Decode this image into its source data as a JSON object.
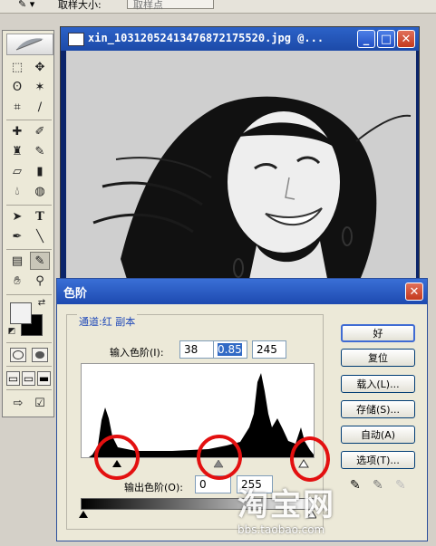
{
  "options_bar": {
    "sample_size_label": "取样大小:",
    "sample_size_value": "取样点"
  },
  "toolbox": {
    "tools": [
      "marquee-icon",
      "move-icon",
      "lasso-icon",
      "magic-wand-icon",
      "crop-icon",
      "slice-icon",
      "healing-brush-icon",
      "brush-icon",
      "clone-stamp-icon",
      "history-brush-icon",
      "eraser-icon",
      "gradient-icon",
      "blur-icon",
      "dodge-icon",
      "path-select-icon",
      "type-icon",
      "pen-icon",
      "line-icon",
      "notes-icon",
      "eyedropper-icon",
      "hand-icon",
      "zoom-icon"
    ],
    "active_tool": "eyedropper-icon",
    "type_tool_glyph": "T"
  },
  "image_window": {
    "title": "xin_1031205241347687217552​0.jpg @...",
    "minimize": "_",
    "maximize": "□",
    "close": "✕"
  },
  "levels_dialog": {
    "title": "色阶",
    "close": "✕",
    "channel_label": "通道:红 副本",
    "input_levels_label": "输入色阶(I):",
    "input_black": "38",
    "input_gamma": "0.85",
    "input_white": "245",
    "output_levels_label": "输出色阶(O):",
    "output_black": "0",
    "output_white": "255",
    "buttons": {
      "ok": "好",
      "reset": "复位",
      "load": "载入(L)...",
      "save": "存储(S)...",
      "auto": "自动(A)",
      "options": "选项(T)..."
    }
  },
  "watermark": {
    "brand": "淘宝网",
    "url": "bbs.taobao.com"
  },
  "colors": {
    "titlebar_blue": "#1d4ab0",
    "annotation_red": "#e31010",
    "dialog_bg": "#ece9d8"
  }
}
